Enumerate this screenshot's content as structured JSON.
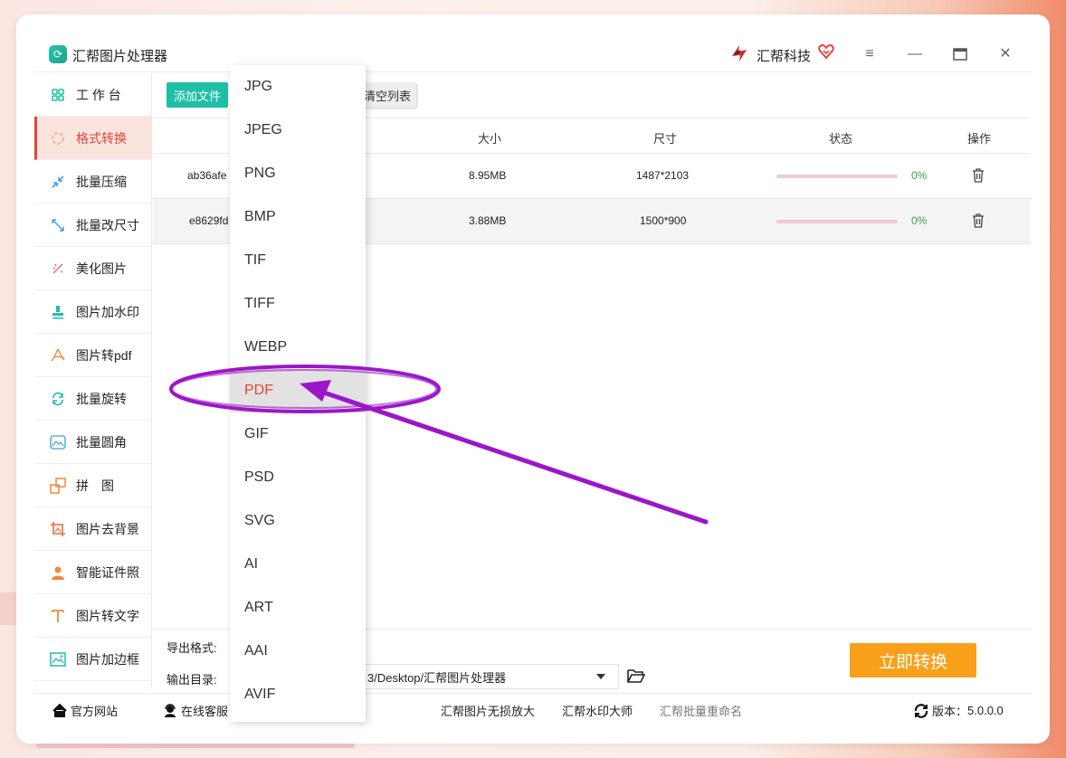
{
  "app": {
    "title": "汇帮图片处理器",
    "brand": "汇帮科技",
    "colors": {
      "accent": "#e0463a",
      "teal": "#1fbfa6",
      "orange": "#f9a01b",
      "annotation": "#9b16c9"
    }
  },
  "sidebar": {
    "items": [
      {
        "label": "工 作 台",
        "icon": "grid-icon"
      },
      {
        "label": "格式转换",
        "icon": "convert-icon",
        "active": true
      },
      {
        "label": "批量压缩",
        "icon": "compress-icon"
      },
      {
        "label": "批量改尺寸",
        "icon": "resize-icon"
      },
      {
        "label": "美化图片",
        "icon": "beautify-icon"
      },
      {
        "label": "图片加水印",
        "icon": "watermark-icon"
      },
      {
        "label": "图片转pdf",
        "icon": "pdf-icon"
      },
      {
        "label": "批量旋转",
        "icon": "rotate-icon"
      },
      {
        "label": "批量圆角",
        "icon": "round-corner-icon"
      },
      {
        "label": "拼　图",
        "icon": "puzzle-icon"
      },
      {
        "label": "图片去背景",
        "icon": "crop-icon"
      },
      {
        "label": "智能证件照",
        "icon": "person-icon"
      },
      {
        "label": "图片转文字",
        "icon": "text-icon"
      },
      {
        "label": "图片加边框",
        "icon": "frame-icon"
      }
    ]
  },
  "toolbar": {
    "add_label": "添加文件",
    "clear_label": "清空列表"
  },
  "table": {
    "headers": {
      "size": "大小",
      "dimension": "尺寸",
      "status": "状态",
      "action": "操作"
    },
    "rows": [
      {
        "name": "ab36afe",
        "size": "8.95MB",
        "dimension": "1487*2103",
        "progress": "0%"
      },
      {
        "name": "e8629fd",
        "size": "3.88MB",
        "dimension": "1500*900",
        "progress": "0%"
      }
    ]
  },
  "bottom": {
    "format_label": "导出格式:",
    "dir_label": "输出目录:",
    "dir_value": "3/Desktop/汇帮图片处理器",
    "convert_label": "立即转换"
  },
  "footer": {
    "website": "官方网站",
    "support": "在线客服",
    "links": [
      "汇帮图片无损放大",
      "汇帮水印大师",
      "汇帮批量重命名"
    ],
    "version_label": "版本：",
    "version": "5.0.0.0"
  },
  "dropdown": {
    "options": [
      "JPG",
      "JPEG",
      "PNG",
      "BMP",
      "TIF",
      "TIFF",
      "WEBP",
      "PDF",
      "GIF",
      "PSD",
      "SVG",
      "AI",
      "ART",
      "AAI",
      "AVIF"
    ],
    "highlighted": "PDF"
  }
}
